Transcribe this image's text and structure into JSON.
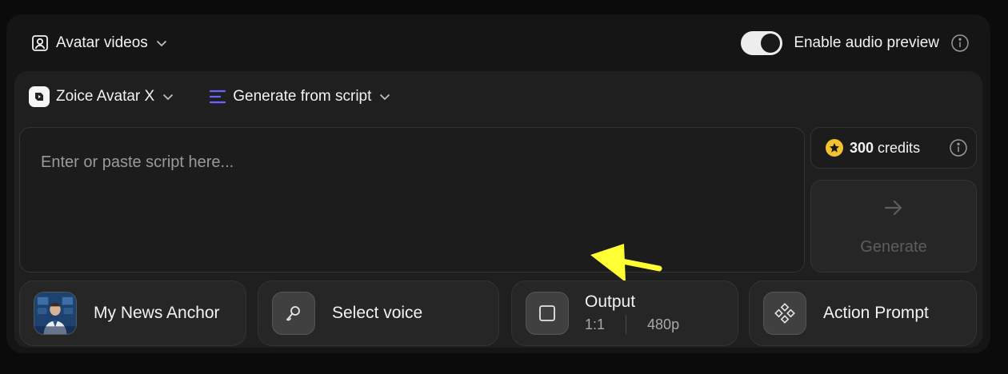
{
  "header": {
    "mode_label": "Avatar videos",
    "audio_preview_label": "Enable audio preview",
    "audio_preview_enabled": true
  },
  "toolbar": {
    "model_label": "Zoice Avatar X",
    "generation_mode_label": "Generate from script"
  },
  "script": {
    "placeholder": "Enter or paste script here...",
    "value": ""
  },
  "credits": {
    "amount": "300",
    "unit": "credits"
  },
  "generate": {
    "label": "Generate"
  },
  "cards": {
    "avatar": {
      "title": "My News Anchor"
    },
    "voice": {
      "title": "Select voice"
    },
    "output": {
      "title": "Output",
      "aspect_ratio": "1:1",
      "resolution": "480p"
    },
    "action": {
      "title": "Action Prompt"
    }
  },
  "icons": {
    "mode": "user-square-icon",
    "info": "info-icon",
    "model_logo": "app-logo-icon",
    "generation_mode": "lines-icon",
    "credits": "star-coin-icon",
    "generate": "arrow-right-icon",
    "voice": "microphone-icon",
    "output": "square-icon",
    "action": "diamond-grid-icon",
    "annotation": "yellow-arrow-icon"
  },
  "colors": {
    "accent_lines": "#6b63ff",
    "coin": "#f2c230",
    "annotation_arrow": "#ffff33"
  }
}
